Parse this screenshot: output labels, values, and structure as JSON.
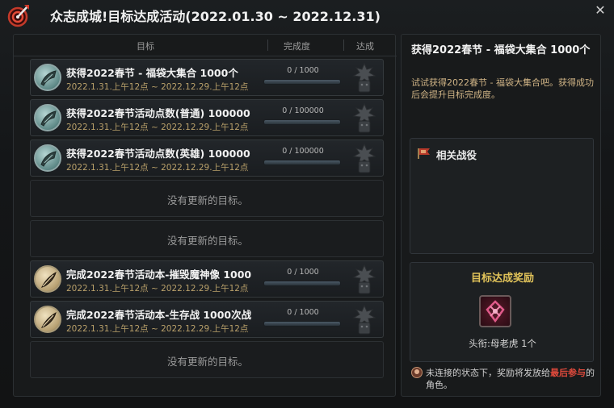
{
  "window": {
    "title": "众志成城!目标达成活动(2022.01.30 ~ 2022.12.31)",
    "close_symbol": "✕"
  },
  "table": {
    "headers": {
      "goal": "目标",
      "progress": "完成度",
      "achieve": "达成"
    },
    "rows": [
      {
        "type": "goal",
        "icon": "horn-icon",
        "title": "获得2022春节 - 福袋大集合 1000个",
        "date": "2022.1.31.上午12点 ~ 2022.12.29.上午12点",
        "progress_text": "0 / 1000",
        "progress_fraction": 0,
        "badge": "demon-statue-icon"
      },
      {
        "type": "goal",
        "icon": "horn-icon",
        "title": "获得2022春节活动点数(普通) 100000",
        "date": "2022.1.31.上午12点 ~ 2022.12.29.上午12点",
        "progress_text": "0 / 100000",
        "progress_fraction": 0,
        "badge": "demon-statue-icon"
      },
      {
        "type": "goal",
        "icon": "horn-icon",
        "title": "获得2022春节活动点数(英雄) 100000",
        "date": "2022.1.31.上午12点 ~ 2022.12.29.上午12点",
        "progress_text": "0 / 100000",
        "progress_fraction": 0,
        "badge": "demon-statue-icon"
      },
      {
        "type": "empty",
        "text": "没有更新的目标。"
      },
      {
        "type": "empty",
        "text": "没有更新的目标。"
      },
      {
        "type": "goal",
        "icon": "quill-icon",
        "title": "完成2022春节活动本-摧毁魔神像 1000",
        "date": "2022.1.31.上午12点 ~ 2022.12.29.上午12点",
        "progress_text": "0 / 1000",
        "progress_fraction": 0,
        "badge": "demon-statue-icon"
      },
      {
        "type": "goal",
        "icon": "quill-icon",
        "title": "完成2022春节活动本-生存战 1000次战",
        "date": "2022.1.31.上午12点 ~ 2022.12.29.上午12点",
        "progress_text": "0 / 1000",
        "progress_fraction": 0,
        "badge": "demon-statue-icon"
      },
      {
        "type": "empty",
        "text": "没有更新的目标。"
      }
    ]
  },
  "detail": {
    "title": "获得2022春节 - 福袋大集合 1000个",
    "description": "试试获得2022春节 - 福袋大集合吧。获得成功后会提升目标完成度。",
    "related_title": "相关战役",
    "reward_title": "目标达成奖励",
    "reward_label": "头衔:母老虎 1个",
    "notice_prefix": "未连接的状态下，奖励将发放给",
    "notice_highlight": "最后参与",
    "notice_suffix": "的角色。"
  },
  "colors": {
    "accent_gold": "#e1c35a",
    "date_text": "#b9a06a",
    "highlight_red": "#e04a3c"
  }
}
